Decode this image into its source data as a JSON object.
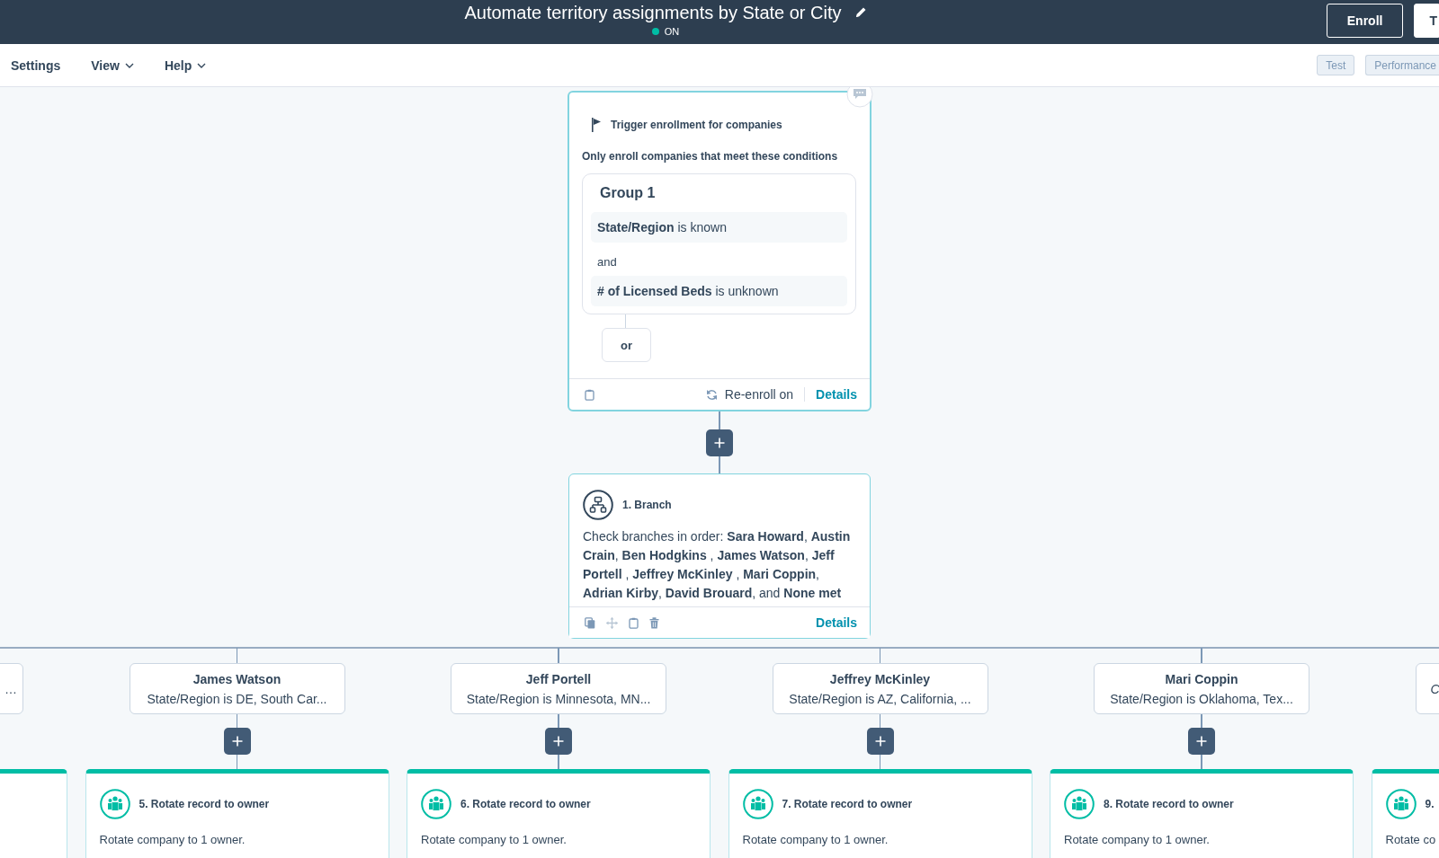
{
  "header": {
    "title": "Automate territory assignments by State or City",
    "status": {
      "label": "ON",
      "on": true
    },
    "buttons": [
      {
        "label": "Enroll",
        "kind": "dark"
      },
      {
        "label": "T",
        "kind": "light"
      }
    ]
  },
  "toolbar": {
    "menus": [
      {
        "label": "Settings",
        "dropdown": false
      },
      {
        "label": "View",
        "dropdown": true
      },
      {
        "label": "Help",
        "dropdown": true
      }
    ],
    "buttons": [
      "Test",
      "Performance"
    ]
  },
  "trigger": {
    "title": "Trigger enrollment for companies",
    "subtitle": "Only enroll companies that meet these conditions",
    "group": {
      "title": "Group 1",
      "joiner": "and",
      "conditions": [
        "**State/Region** is known",
        "**# of Licensed Beds** is unknown"
      ]
    },
    "or_button": "or",
    "reenroll": "Re-enroll on",
    "details": "Details"
  },
  "branch": {
    "title": "1. Branch",
    "description": "Check branches in order: **Sara Howard**, **Austin Crain**, **Ben Hodgkins** , **James Watson**, **Jeff Portell** , **Jeffrey McKinley** , **Mari Coppin**, **Adrian Kirby**, **David Brouard**, and **None met**",
    "details": "Details"
  },
  "branches": [
    {
      "condition": "…"
    },
    {
      "name": "James Watson",
      "condition": "State/Region is DE, South Car..."
    },
    {
      "name": "Jeff Portell",
      "condition": "State/Region is Minnesota, MN..."
    },
    {
      "name": "Jeffrey McKinley",
      "condition": "State/Region is AZ, California, ..."
    },
    {
      "name": "Mari Coppin",
      "condition": "State/Region is Oklahoma, Tex..."
    },
    {
      "condition": "C"
    }
  ],
  "actions": [
    {
      "kind": "edge"
    },
    {
      "kind": "step",
      "title": "5. Rotate record to owner",
      "text": "Rotate company to 1 owner."
    },
    {
      "kind": "step",
      "title": "6. Rotate record to owner",
      "text": "Rotate company to 1 owner."
    },
    {
      "kind": "step",
      "title": "7. Rotate record to owner",
      "text": "Rotate company to 1 owner."
    },
    {
      "kind": "step",
      "title": "8. Rotate record to owner",
      "text": "Rotate company to 1 owner."
    },
    {
      "kind": "step",
      "title": "9.",
      "text": "Rotate co"
    }
  ]
}
